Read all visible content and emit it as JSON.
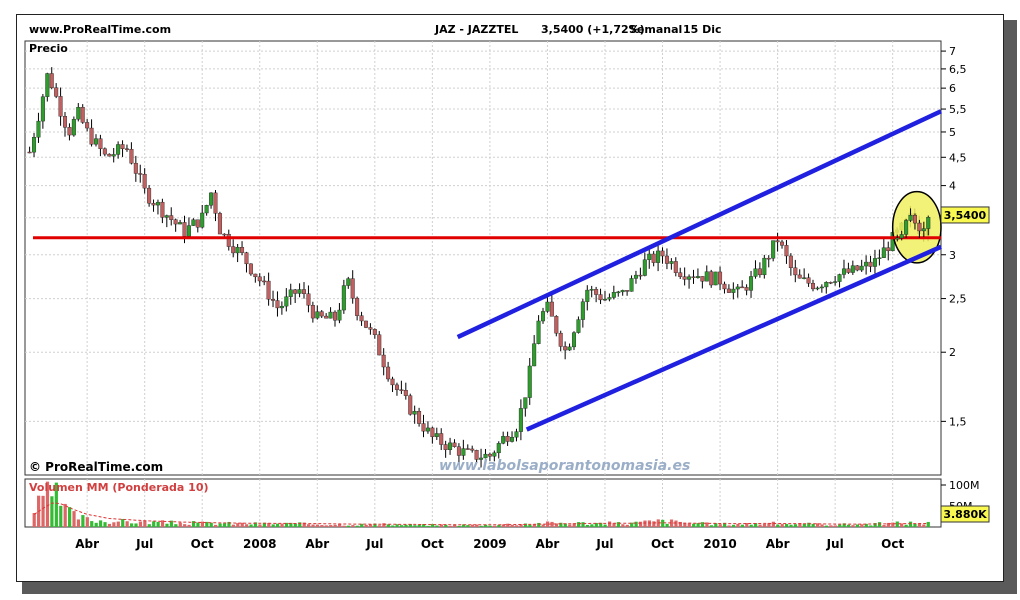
{
  "header": {
    "site": "www.ProRealTime.com",
    "instrument": "JAZ - JAZZTEL",
    "quote": "3,5400 (+1,72%)",
    "period": "Semanal",
    "date": "15 Dic"
  },
  "footer": {
    "copyright": "© ProRealTime.com",
    "watermark": "www.labolsaporantonomasia.es"
  },
  "colors": {
    "up": "#2e9d2e",
    "down": "#c06060",
    "channel": "#2020e0",
    "support": "#e00000",
    "highlight": "#f0ee60",
    "volume_up": "#33bb33",
    "volume_down": "#dd6666"
  },
  "chart_data": [
    {
      "type": "line",
      "panel": "price",
      "ylabel": "Precio",
      "scale": "log",
      "ylim": [
        1.2,
        7.3
      ],
      "y_ticks": [
        7,
        6.5,
        6,
        5.5,
        5,
        4.5,
        4,
        3.5,
        3,
        2.5,
        2,
        1.5
      ],
      "y_tick_labels": [
        "7",
        "6,5",
        "6",
        "5,5",
        "5",
        "4,5",
        "4",
        "3,5",
        "3",
        "2,5",
        "2",
        "1,5"
      ],
      "x_tick_labels": [
        "Abr",
        "Jul",
        "Oct",
        "2008",
        "Abr",
        "Jul",
        "Oct",
        "2009",
        "Abr",
        "Jul",
        "Oct",
        "2010",
        "Abr",
        "Jul",
        "Oct"
      ],
      "x_tick_positions": [
        2007.25,
        2007.5,
        2007.75,
        2008.0,
        2008.25,
        2008.5,
        2008.75,
        2009.0,
        2009.25,
        2009.5,
        2009.75,
        2010.0,
        2010.25,
        2010.5,
        2010.75
      ],
      "xlim": [
        2006.98,
        2010.96
      ],
      "grid": true,
      "last_value": 3.54,
      "last_value_label": "3,5400",
      "series": [
        {
          "x": [
            2007.0,
            2007.04,
            2007.08,
            2007.12,
            2007.17,
            2007.21,
            2007.25,
            2007.33,
            2007.42,
            2007.5,
            2007.58,
            2007.67,
            2007.75,
            2007.79,
            2007.83,
            2007.92,
            2008.0,
            2008.08,
            2008.17,
            2008.25,
            2008.33,
            2008.38,
            2008.42,
            2008.5,
            2008.58,
            2008.67,
            2008.75,
            2008.83,
            2008.92,
            2009.0,
            2009.06,
            2009.12,
            2009.17,
            2009.21,
            2009.25,
            2009.33,
            2009.42,
            2009.5,
            2009.58,
            2009.67,
            2009.75,
            2009.83,
            2009.92,
            2010.0,
            2010.08,
            2010.17,
            2010.25,
            2010.33,
            2010.42,
            2010.5,
            2010.58,
            2010.67,
            2010.75,
            2010.83,
            2010.88,
            2010.92
          ],
          "values": [
            4.6,
            5.4,
            6.4,
            5.7,
            5.0,
            5.4,
            5.0,
            4.5,
            4.7,
            3.9,
            3.6,
            3.3,
            3.5,
            3.9,
            3.3,
            3.0,
            2.7,
            2.4,
            2.6,
            2.3,
            2.3,
            2.7,
            2.4,
            2.1,
            1.75,
            1.55,
            1.4,
            1.35,
            1.3,
            1.3,
            1.4,
            1.48,
            1.8,
            2.3,
            2.4,
            2.0,
            2.6,
            2.5,
            2.55,
            2.9,
            3.0,
            2.8,
            2.75,
            2.7,
            2.55,
            2.8,
            3.2,
            2.7,
            2.65,
            2.75,
            2.8,
            2.9,
            3.2,
            3.5,
            3.3,
            3.54
          ]
        }
      ],
      "annotations": {
        "support_level": 3.22,
        "channel_upper": {
          "x": [
            2008.86,
            2010.96
          ],
          "y": [
            2.13,
            5.45
          ]
        },
        "channel_lower": {
          "x": [
            2009.16,
            2010.96
          ],
          "y": [
            1.45,
            3.1
          ]
        },
        "highlight": {
          "x": [
            2010.75,
            2010.96
          ],
          "y": [
            2.9,
            3.9
          ]
        }
      }
    },
    {
      "type": "bar",
      "panel": "volume",
      "title": "Volumen MM (Ponderada 10)",
      "y_tick_labels": [
        "100M",
        "50M"
      ],
      "y_ticks": [
        100,
        50
      ],
      "last_value_label": "3.880K",
      "x": [
        2007.02,
        2007.06,
        2007.1,
        2007.14,
        2007.18,
        2007.25,
        2007.35,
        2007.5,
        2007.65,
        2007.8,
        2007.95,
        2008.1,
        2008.25,
        2008.4,
        2008.55,
        2008.7,
        2008.85,
        2009.0,
        2009.15,
        2009.3,
        2009.45,
        2009.6,
        2009.75,
        2009.9,
        2010.05,
        2010.2,
        2010.35,
        2010.5,
        2010.65,
        2010.8,
        2010.92
      ],
      "values": [
        40,
        65,
        85,
        55,
        30,
        18,
        14,
        12,
        10,
        9,
        8,
        8,
        7,
        6,
        6,
        5,
        5,
        5,
        8,
        10,
        9,
        9,
        15,
        8,
        7,
        9,
        7,
        6,
        7,
        10,
        9
      ],
      "ma_values": [
        30,
        45,
        58,
        55,
        44,
        30,
        20,
        15,
        12,
        10,
        9,
        8.5,
        8,
        7,
        6.5,
        6,
        5.5,
        5.3,
        6,
        7.5,
        8.5,
        9,
        10,
        9,
        8,
        8.5,
        8,
        7,
        7,
        8,
        8.5
      ]
    }
  ]
}
